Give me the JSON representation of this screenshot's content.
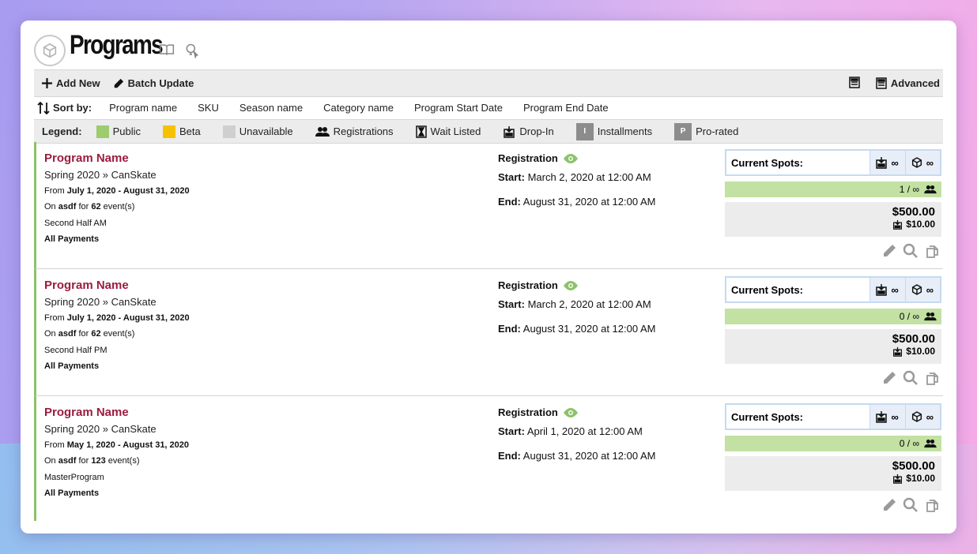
{
  "header": {
    "title": "Programs"
  },
  "toolbar": {
    "add_new": "Add New",
    "batch_update": "Batch Update",
    "advanced": "Advanced"
  },
  "sort": {
    "label": "Sort by:",
    "options": [
      "Program name",
      "SKU",
      "Season name",
      "Category name",
      "Program Start Date",
      "Program End Date"
    ]
  },
  "legend": {
    "label": "Legend:",
    "public": "Public",
    "beta": "Beta",
    "unavailable": "Unavailable",
    "registrations": "Registrations",
    "wait_listed": "Wait Listed",
    "drop_in": "Drop-In",
    "installments": "Installments",
    "installments_badge": "I",
    "prorated": "Pro-rated",
    "prorated_badge": "P",
    "colors": {
      "public": "#9ccc6e",
      "beta": "#f5c200",
      "unavailable": "#cfcfcf"
    }
  },
  "programs": [
    {
      "name": "Program Name",
      "season": "Spring 2020 » CanSkate",
      "from_label": "From",
      "dates": "July 1, 2020 - August 31, 2020",
      "on_label": "On",
      "location": "asdf",
      "for_label": "for",
      "event_count": "62",
      "events_label": "event(s)",
      "session": "Second Half AM",
      "payments": "All Payments",
      "reg_label": "Registration",
      "start_label": "Start:",
      "start": "March 2, 2020 at 12:00 AM",
      "end_label": "End:",
      "end": "August 31, 2020 at 12:00 AM",
      "spots_label": "Current Spots:",
      "dropin_spots": "∞",
      "package_spots": "∞",
      "registered": "1 / ∞",
      "price": "$500.00",
      "dropin_price": "$10.00"
    },
    {
      "name": "Program Name",
      "season": "Spring 2020 » CanSkate",
      "from_label": "From",
      "dates": "July 1, 2020 - August 31, 2020",
      "on_label": "On",
      "location": "asdf",
      "for_label": "for",
      "event_count": "62",
      "events_label": "event(s)",
      "session": "Second Half PM",
      "payments": "All Payments",
      "reg_label": "Registration",
      "start_label": "Start:",
      "start": "March 2, 2020 at 12:00 AM",
      "end_label": "End:",
      "end": "August 31, 2020 at 12:00 AM",
      "spots_label": "Current Spots:",
      "dropin_spots": "∞",
      "package_spots": "∞",
      "registered": "0 / ∞",
      "price": "$500.00",
      "dropin_price": "$10.00"
    },
    {
      "name": "Program Name",
      "season": "Spring 2020 » CanSkate",
      "from_label": "From",
      "dates": "May 1, 2020 - August 31, 2020",
      "on_label": "On",
      "location": "asdf",
      "for_label": "for",
      "event_count": "123",
      "events_label": "event(s)",
      "session": "MasterProgram",
      "payments": "All Payments",
      "reg_label": "Registration",
      "start_label": "Start:",
      "start": "April 1, 2020 at 12:00 AM",
      "end_label": "End:",
      "end": "August 31, 2020 at 12:00 AM",
      "spots_label": "Current Spots:",
      "dropin_spots": "∞",
      "package_spots": "∞",
      "registered": "0 / ∞",
      "price": "$500.00",
      "dropin_price": "$10.00"
    }
  ]
}
